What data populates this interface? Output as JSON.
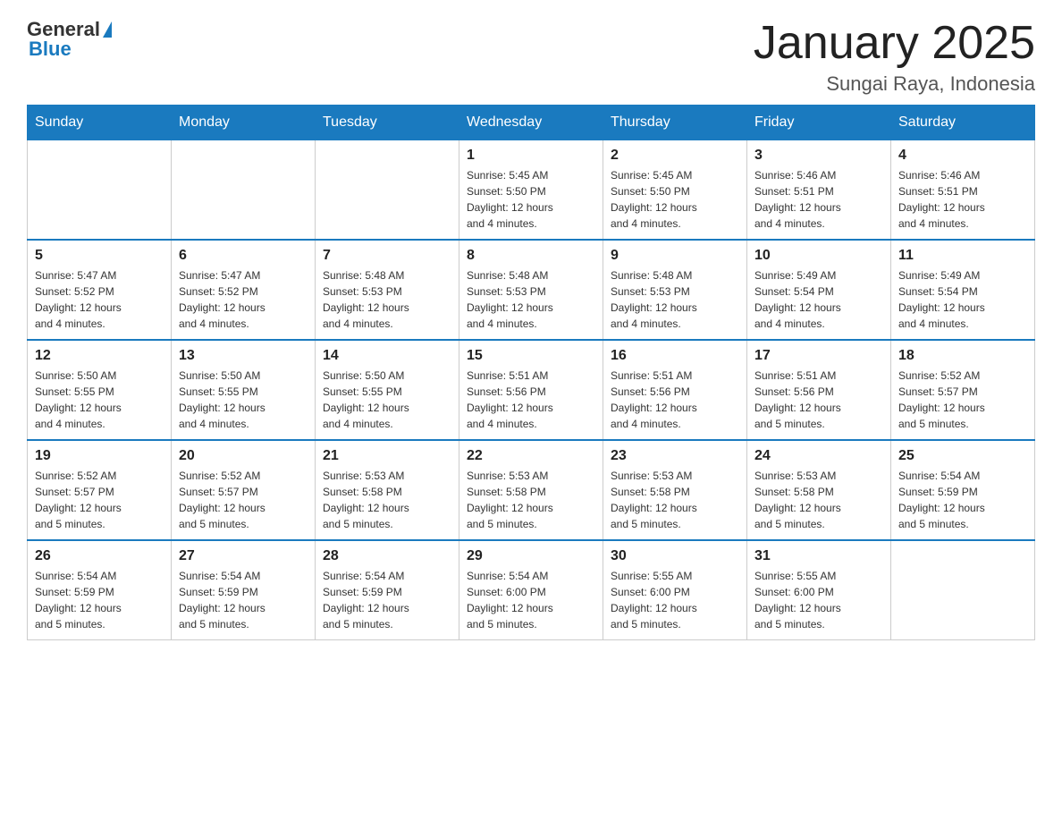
{
  "header": {
    "logo_general": "General",
    "logo_blue": "Blue",
    "title": "January 2025",
    "location": "Sungai Raya, Indonesia"
  },
  "days_of_week": [
    "Sunday",
    "Monday",
    "Tuesday",
    "Wednesday",
    "Thursday",
    "Friday",
    "Saturday"
  ],
  "weeks": [
    [
      {
        "day": "",
        "info": ""
      },
      {
        "day": "",
        "info": ""
      },
      {
        "day": "",
        "info": ""
      },
      {
        "day": "1",
        "info": "Sunrise: 5:45 AM\nSunset: 5:50 PM\nDaylight: 12 hours\nand 4 minutes."
      },
      {
        "day": "2",
        "info": "Sunrise: 5:45 AM\nSunset: 5:50 PM\nDaylight: 12 hours\nand 4 minutes."
      },
      {
        "day": "3",
        "info": "Sunrise: 5:46 AM\nSunset: 5:51 PM\nDaylight: 12 hours\nand 4 minutes."
      },
      {
        "day": "4",
        "info": "Sunrise: 5:46 AM\nSunset: 5:51 PM\nDaylight: 12 hours\nand 4 minutes."
      }
    ],
    [
      {
        "day": "5",
        "info": "Sunrise: 5:47 AM\nSunset: 5:52 PM\nDaylight: 12 hours\nand 4 minutes."
      },
      {
        "day": "6",
        "info": "Sunrise: 5:47 AM\nSunset: 5:52 PM\nDaylight: 12 hours\nand 4 minutes."
      },
      {
        "day": "7",
        "info": "Sunrise: 5:48 AM\nSunset: 5:53 PM\nDaylight: 12 hours\nand 4 minutes."
      },
      {
        "day": "8",
        "info": "Sunrise: 5:48 AM\nSunset: 5:53 PM\nDaylight: 12 hours\nand 4 minutes."
      },
      {
        "day": "9",
        "info": "Sunrise: 5:48 AM\nSunset: 5:53 PM\nDaylight: 12 hours\nand 4 minutes."
      },
      {
        "day": "10",
        "info": "Sunrise: 5:49 AM\nSunset: 5:54 PM\nDaylight: 12 hours\nand 4 minutes."
      },
      {
        "day": "11",
        "info": "Sunrise: 5:49 AM\nSunset: 5:54 PM\nDaylight: 12 hours\nand 4 minutes."
      }
    ],
    [
      {
        "day": "12",
        "info": "Sunrise: 5:50 AM\nSunset: 5:55 PM\nDaylight: 12 hours\nand 4 minutes."
      },
      {
        "day": "13",
        "info": "Sunrise: 5:50 AM\nSunset: 5:55 PM\nDaylight: 12 hours\nand 4 minutes."
      },
      {
        "day": "14",
        "info": "Sunrise: 5:50 AM\nSunset: 5:55 PM\nDaylight: 12 hours\nand 4 minutes."
      },
      {
        "day": "15",
        "info": "Sunrise: 5:51 AM\nSunset: 5:56 PM\nDaylight: 12 hours\nand 4 minutes."
      },
      {
        "day": "16",
        "info": "Sunrise: 5:51 AM\nSunset: 5:56 PM\nDaylight: 12 hours\nand 4 minutes."
      },
      {
        "day": "17",
        "info": "Sunrise: 5:51 AM\nSunset: 5:56 PM\nDaylight: 12 hours\nand 5 minutes."
      },
      {
        "day": "18",
        "info": "Sunrise: 5:52 AM\nSunset: 5:57 PM\nDaylight: 12 hours\nand 5 minutes."
      }
    ],
    [
      {
        "day": "19",
        "info": "Sunrise: 5:52 AM\nSunset: 5:57 PM\nDaylight: 12 hours\nand 5 minutes."
      },
      {
        "day": "20",
        "info": "Sunrise: 5:52 AM\nSunset: 5:57 PM\nDaylight: 12 hours\nand 5 minutes."
      },
      {
        "day": "21",
        "info": "Sunrise: 5:53 AM\nSunset: 5:58 PM\nDaylight: 12 hours\nand 5 minutes."
      },
      {
        "day": "22",
        "info": "Sunrise: 5:53 AM\nSunset: 5:58 PM\nDaylight: 12 hours\nand 5 minutes."
      },
      {
        "day": "23",
        "info": "Sunrise: 5:53 AM\nSunset: 5:58 PM\nDaylight: 12 hours\nand 5 minutes."
      },
      {
        "day": "24",
        "info": "Sunrise: 5:53 AM\nSunset: 5:58 PM\nDaylight: 12 hours\nand 5 minutes."
      },
      {
        "day": "25",
        "info": "Sunrise: 5:54 AM\nSunset: 5:59 PM\nDaylight: 12 hours\nand 5 minutes."
      }
    ],
    [
      {
        "day": "26",
        "info": "Sunrise: 5:54 AM\nSunset: 5:59 PM\nDaylight: 12 hours\nand 5 minutes."
      },
      {
        "day": "27",
        "info": "Sunrise: 5:54 AM\nSunset: 5:59 PM\nDaylight: 12 hours\nand 5 minutes."
      },
      {
        "day": "28",
        "info": "Sunrise: 5:54 AM\nSunset: 5:59 PM\nDaylight: 12 hours\nand 5 minutes."
      },
      {
        "day": "29",
        "info": "Sunrise: 5:54 AM\nSunset: 6:00 PM\nDaylight: 12 hours\nand 5 minutes."
      },
      {
        "day": "30",
        "info": "Sunrise: 5:55 AM\nSunset: 6:00 PM\nDaylight: 12 hours\nand 5 minutes."
      },
      {
        "day": "31",
        "info": "Sunrise: 5:55 AM\nSunset: 6:00 PM\nDaylight: 12 hours\nand 5 minutes."
      },
      {
        "day": "",
        "info": ""
      }
    ]
  ]
}
